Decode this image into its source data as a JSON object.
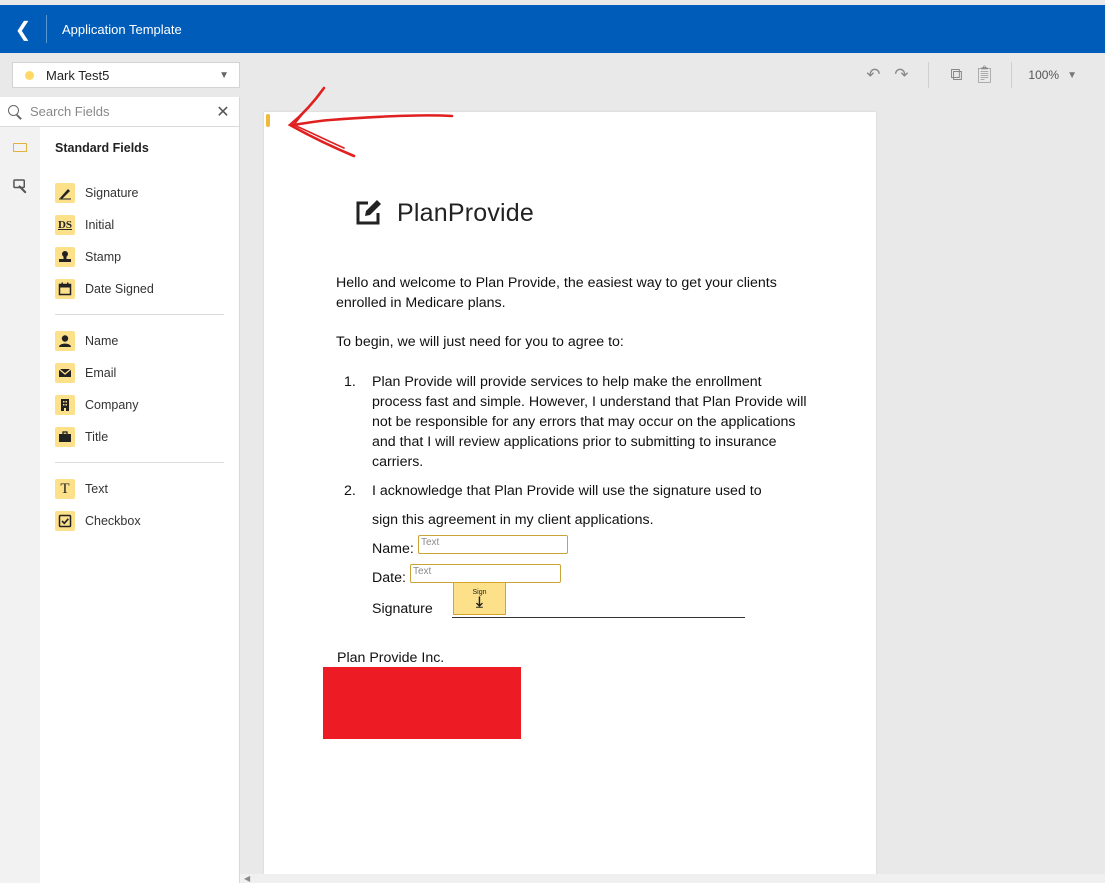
{
  "header": {
    "title": "Application Template"
  },
  "recipient": {
    "name": "Mark Test5"
  },
  "toolbar": {
    "zoom": "100%"
  },
  "search": {
    "placeholder": "Search Fields"
  },
  "fields": {
    "title": "Standard Fields",
    "group1": [
      {
        "label": "Signature",
        "icon": "pen-icon"
      },
      {
        "label": "Initial",
        "icon": "ds-icon"
      },
      {
        "label": "Stamp",
        "icon": "stamp-icon"
      },
      {
        "label": "Date Signed",
        "icon": "calendar-icon"
      }
    ],
    "group2": [
      {
        "label": "Name",
        "icon": "person-icon"
      },
      {
        "label": "Email",
        "icon": "envelope-icon"
      },
      {
        "label": "Company",
        "icon": "building-icon"
      },
      {
        "label": "Title",
        "icon": "briefcase-icon"
      }
    ],
    "group3": [
      {
        "label": "Text",
        "icon": "text-icon"
      },
      {
        "label": "Checkbox",
        "icon": "checkbox-icon"
      }
    ]
  },
  "document": {
    "logo": "PlanProvide",
    "p1": "Hello and welcome to Plan Provide, the easiest way to get your clients enrolled in Medicare plans.",
    "p2": "To begin, we will just need for you to agree to:",
    "li1_num": "1.",
    "li1": "Plan Provide will provide services to help make the enrollment process fast and simple. However, I understand that Plan Provide will not be responsible for any errors that may occur on the applications and that I will review applications prior to submitting to insurance carriers.",
    "li2_num": "2.",
    "li2": "I acknowledge that Plan Provide will use the signature used to",
    "li2b": "sign this agreement in my client applications.",
    "name_label": "Name:",
    "date_label": "Date:",
    "signature_label": "Signature",
    "text_field": "Text",
    "sign_label": "Sign",
    "footer": "Plan Provide Inc."
  },
  "colors": {
    "header": "#005cb9",
    "field_icon": "#fde08a",
    "annotation": "#e02020",
    "redaction": "#ed1c24"
  }
}
